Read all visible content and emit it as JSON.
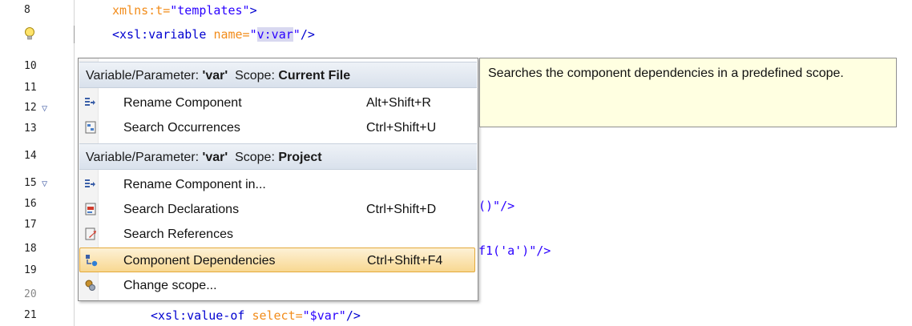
{
  "gutter": {
    "lines": [
      {
        "no": "8",
        "fold": ""
      },
      {
        "no": "",
        "fold": "",
        "bulb": true
      },
      {
        "no": "10",
        "fold": ""
      },
      {
        "no": "11",
        "fold": ""
      },
      {
        "no": "12",
        "fold": "▽"
      },
      {
        "no": "13",
        "fold": ""
      },
      {
        "no": "14",
        "fold": ""
      },
      {
        "no": "15",
        "fold": "▽"
      },
      {
        "no": "16",
        "fold": ""
      },
      {
        "no": "17",
        "fold": ""
      },
      {
        "no": "18",
        "fold": ""
      },
      {
        "no": "19",
        "fold": ""
      },
      {
        "no": "20",
        "fold": ""
      },
      {
        "no": "21",
        "fold": ""
      }
    ]
  },
  "code": {
    "line8": {
      "attr": "xmlns:t=",
      "val": "\"templates\"",
      "end": ">"
    },
    "line9": {
      "open": "<xsl:variable ",
      "attr": "name=",
      "q1": "\"",
      "sel": "v:var",
      "q2": "\"",
      "end": "/>"
    },
    "line16_tail": "()\"/>",
    "line18_tail": "f1('a')\"/>",
    "line21": {
      "open": "<xsl:value-of ",
      "attr": "select=",
      "val": "\"$var\"",
      "end": "/>"
    }
  },
  "menu": {
    "sections": [
      {
        "prefix": "Variable/Parameter: ",
        "name": "'var'",
        "scope_label": "  Scope: ",
        "scope": "Current File",
        "items": [
          {
            "icon": "rename-icon",
            "label": "Rename Component",
            "shortcut": "Alt+Shift+R"
          },
          {
            "icon": "search-occurrences-icon",
            "label": "Search Occurrences",
            "shortcut": "Ctrl+Shift+U"
          }
        ]
      },
      {
        "prefix": "Variable/Parameter: ",
        "name": "'var'",
        "scope_label": "  Scope: ",
        "scope": "Project",
        "items": [
          {
            "icon": "rename-icon",
            "label": "Rename Component in...",
            "shortcut": ""
          },
          {
            "icon": "search-declarations-icon",
            "label": "Search Declarations",
            "shortcut": "Ctrl+Shift+D"
          },
          {
            "icon": "search-references-icon",
            "label": "Search References",
            "shortcut": ""
          },
          {
            "icon": "component-dependencies-icon",
            "label": "Component Dependencies",
            "shortcut": "Ctrl+Shift+F4"
          },
          {
            "icon": "change-scope-icon",
            "label": "Change scope...",
            "shortcut": ""
          }
        ]
      }
    ],
    "selected_label": "Component Dependencies"
  },
  "tooltip": {
    "text": "Searches the component dependencies in a predefined scope."
  },
  "colors": {
    "tag": "#0000d0",
    "attr": "#f28c1a",
    "string": "#2a00ff",
    "selection_bg": "#f8d891",
    "tooltip_bg": "#ffffe1"
  }
}
